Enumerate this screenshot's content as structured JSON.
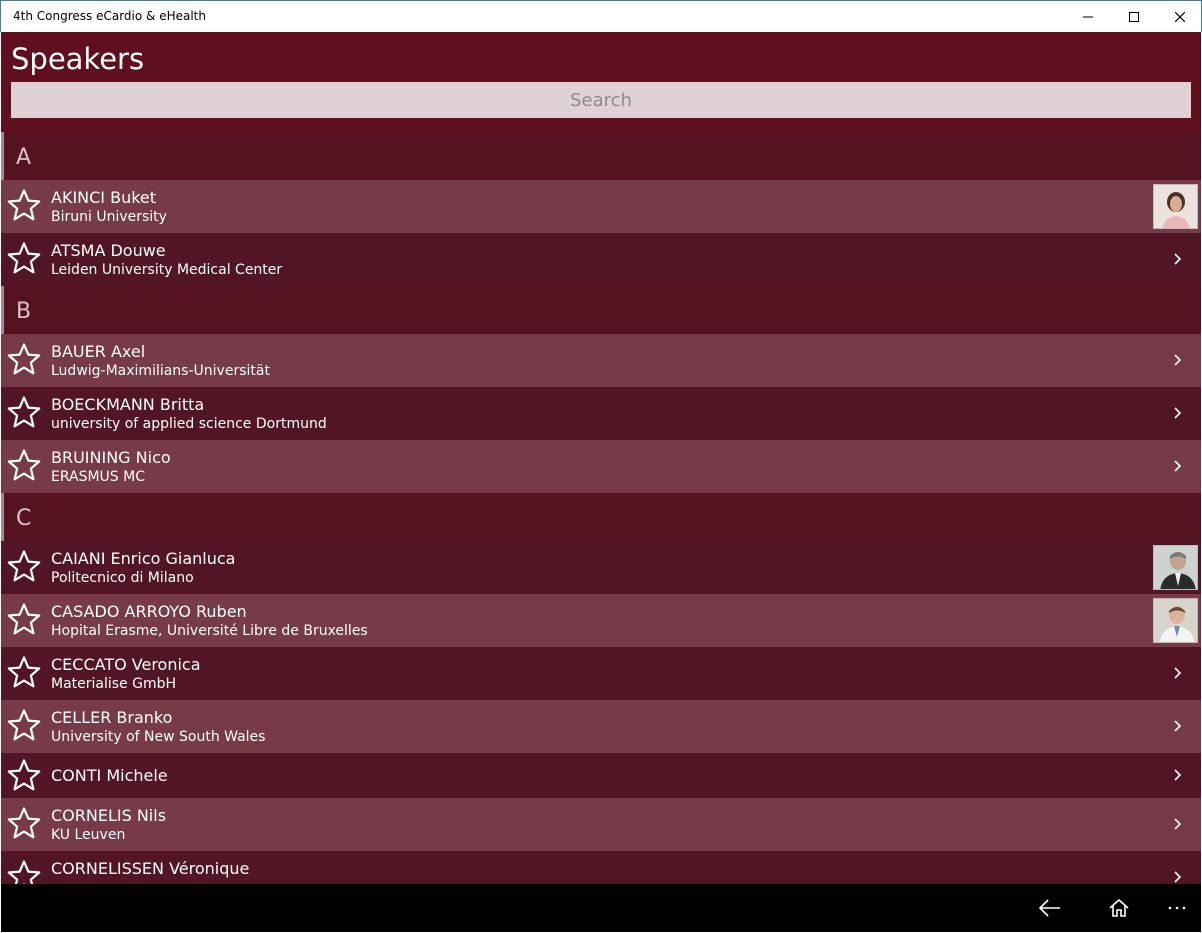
{
  "window": {
    "title": "4th Congress eCardio & eHealth"
  },
  "header": {
    "title": "Speakers"
  },
  "search": {
    "placeholder": "Search"
  },
  "groups": [
    "A",
    "B",
    "C"
  ],
  "speakers": [
    {
      "name": "AKINCI Buket",
      "affiliation": "Biruni University",
      "has_photo": true
    },
    {
      "name": "ATSMA Douwe",
      "affiliation": "Leiden University Medical Center",
      "has_photo": false
    },
    {
      "name": "BAUER Axel",
      "affiliation": "Ludwig-Maximilians-Universität",
      "has_photo": false
    },
    {
      "name": "BOECKMANN Britta",
      "affiliation": "university of applied science Dortmund",
      "has_photo": false
    },
    {
      "name": "BRUINING Nico",
      "affiliation": "ERASMUS MC",
      "has_photo": false
    },
    {
      "name": "CAIANI Enrico Gianluca",
      "affiliation": "Politecnico di Milano",
      "has_photo": true
    },
    {
      "name": "CASADO ARROYO Ruben",
      "affiliation": "Hopital Erasme, Université Libre de Bruxelles",
      "has_photo": true
    },
    {
      "name": "CECCATO Veronica",
      "affiliation": "Materialise GmbH",
      "has_photo": false
    },
    {
      "name": "CELLER Branko",
      "affiliation": "University of New South Wales",
      "has_photo": false
    },
    {
      "name": "CONTI Michele",
      "affiliation": "",
      "has_photo": false
    },
    {
      "name": "CORNELIS Nils",
      "affiliation": "KU Leuven",
      "has_photo": false
    },
    {
      "name": "CORNELISSEN Véronique",
      "affiliation": "",
      "has_photo": false
    }
  ],
  "icons": {
    "favorite": "star-outline-icon",
    "navigate": "chevron-right-icon",
    "back": "back-arrow-icon",
    "home": "home-icon",
    "more": "more-icon"
  },
  "colors": {
    "header_bg": "#600f1e",
    "row_light": "#763a48",
    "row_dark": "#521525",
    "search_bg": "#e0d1d4"
  }
}
